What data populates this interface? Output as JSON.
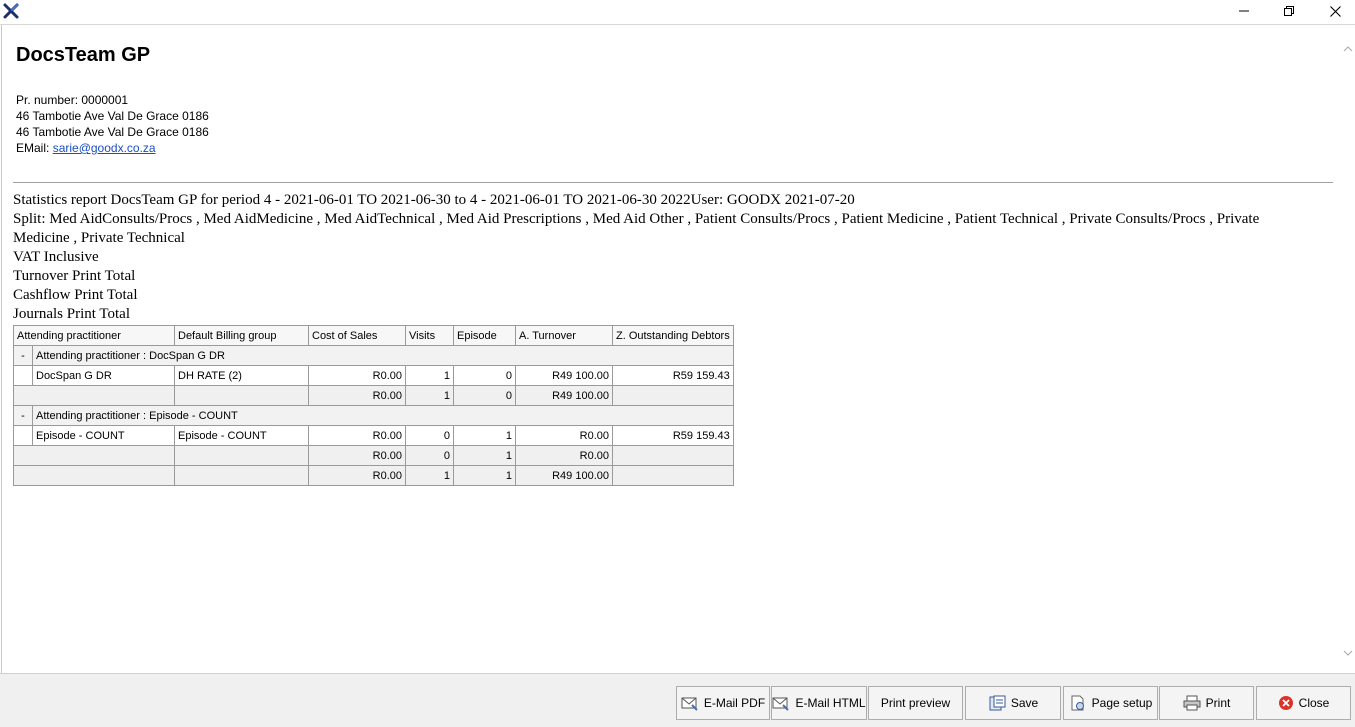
{
  "window": {
    "app_icon": "goodx-x-icon",
    "minimize_icon": "minimize-icon",
    "maximize_icon": "restore-icon",
    "close_icon": "close-icon"
  },
  "header": {
    "practice_name": "DocsTeam GP",
    "pr_number": "Pr. number: 0000001",
    "address_line1": "46 Tambotie Ave Val De Grace 0186",
    "address_line2": "46 Tambotie Ave Val De Grace 0186",
    "email_label": "EMail: ",
    "email": "sarie@goodx.co.za"
  },
  "report": {
    "title_line": "Statistics report DocsTeam GP for period 4 - 2021-06-01 TO 2021-06-30 to 4 - 2021-06-01 TO 2021-06-30 2022User: GOODX 2021-07-20",
    "split_line": "Split: Med AidConsults/Procs , Med AidMedicine , Med AidTechnical , Med Aid Prescriptions , Med Aid Other , Patient Consults/Procs , Patient Medicine , Patient Technical , Private Consults/Procs , Private Medicine , Private Technical",
    "vat_line": "VAT Inclusive",
    "turnover_line": "Turnover Print Total",
    "cashflow_line": "Cashflow Print Total",
    "journals_line": "Journals Print Total"
  },
  "table": {
    "columns": [
      "Attending practitioner",
      "Default Billing group",
      "Cost of Sales",
      "Visits",
      "Episode",
      "A. Turnover",
      "Z. Outstanding Debtors"
    ],
    "groups": [
      {
        "toggle": "-",
        "label": "Attending practitioner : DocSpan G DR",
        "rows": [
          {
            "practitioner": "DocSpan G DR",
            "billing_group": "DH RATE (2)",
            "cost_of_sales": "R0.00",
            "visits": "1",
            "episode": "0",
            "turnover": "R49 100.00",
            "debtors": "R59 159.43"
          }
        ],
        "subtotal": {
          "cost_of_sales": "R0.00",
          "visits": "1",
          "episode": "0",
          "turnover": "R49 100.00",
          "debtors": ""
        }
      },
      {
        "toggle": "-",
        "label": "Attending practitioner : Episode - COUNT",
        "rows": [
          {
            "practitioner": "Episode - COUNT",
            "billing_group": "Episode - COUNT",
            "cost_of_sales": "R0.00",
            "visits": "0",
            "episode": "1",
            "turnover": "R0.00",
            "debtors": "R59 159.43"
          }
        ],
        "subtotal": {
          "cost_of_sales": "R0.00",
          "visits": "0",
          "episode": "1",
          "turnover": "R0.00",
          "debtors": ""
        }
      }
    ],
    "grand_total": {
      "cost_of_sales": "R0.00",
      "visits": "1",
      "episode": "1",
      "turnover": "R49 100.00",
      "debtors": ""
    }
  },
  "toolbar": {
    "email_pdf": "E-Mail PDF",
    "email_html": "E-Mail HTML",
    "print_preview": "Print preview",
    "save": "Save",
    "page_setup": "Page setup",
    "print": "Print",
    "close": "Close"
  },
  "colors": {
    "link": "#1a4fc4",
    "close_red": "#d9342b"
  }
}
